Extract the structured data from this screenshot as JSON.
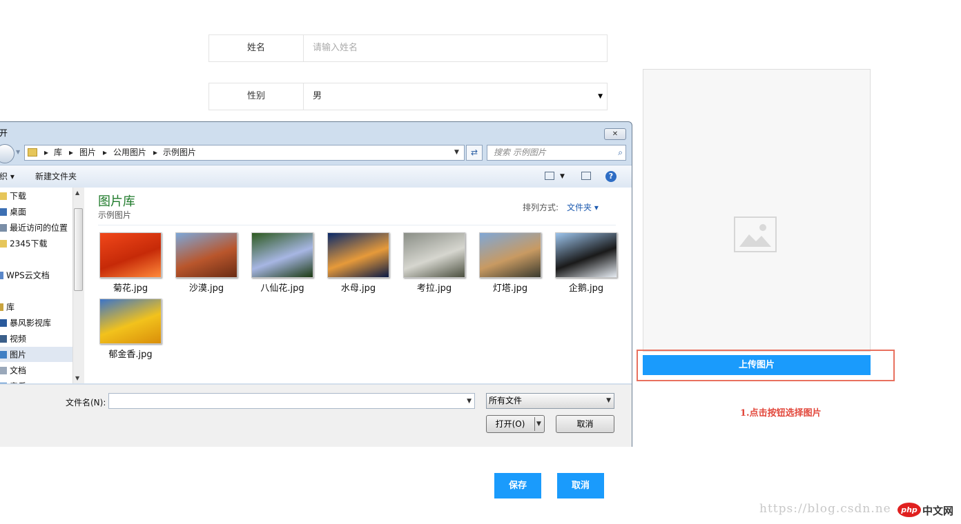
{
  "form": {
    "name_label": "姓名",
    "name_placeholder": "请输入姓名",
    "gender_label": "性别",
    "gender_value": "男"
  },
  "upload": {
    "button_label": "上传图片",
    "tip": "1.点击按钮选择图片"
  },
  "actions": {
    "save_label": "保存",
    "cancel_label": "取消"
  },
  "watermark": {
    "url_text": "https://blog.csdn.ne",
    "php_logo": "php",
    "site_text": "中文网"
  },
  "dialog": {
    "title": "开",
    "close_glyph": "✕",
    "breadcrumb": [
      "库",
      "图片",
      "公用图片",
      "示例图片"
    ],
    "search_placeholder": "搜索 示例图片",
    "toolbar": {
      "organize": "织 ▾",
      "new_folder": "新建文件夹"
    },
    "sidebar": [
      {
        "label": "下载",
        "icon": "download-folder-icon",
        "color": "#e6c65a"
      },
      {
        "label": "桌面",
        "icon": "desktop-icon",
        "color": "#3c6fb3"
      },
      {
        "label": "最近访问的位置",
        "icon": "recent-places-icon",
        "color": "#7a8ea7"
      },
      {
        "label": "2345下载",
        "icon": "folder-icon",
        "color": "#e6c65a"
      },
      {
        "label": "WPS云文档",
        "icon": "cloud-doc-icon",
        "color": "#5a87c9"
      },
      {
        "label": "库",
        "icon": "library-icon",
        "color": "#c9a43f"
      },
      {
        "label": "暴风影视库",
        "icon": "video-library-icon",
        "color": "#2a5a9c"
      },
      {
        "label": "视频",
        "icon": "video-icon",
        "color": "#3b5f8a"
      },
      {
        "label": "图片",
        "icon": "pictures-icon",
        "color": "#3f7fc4",
        "selected": true
      },
      {
        "label": "文档",
        "icon": "documents-icon",
        "color": "#9aa8ba"
      },
      {
        "label": "音乐",
        "icon": "music-icon",
        "color": "#3f7fc4"
      }
    ],
    "library_title": "图片库",
    "library_subtitle": "示例图片",
    "sort_label": "排列方式:",
    "sort_value": "文件夹 ▾",
    "files": [
      {
        "name": "菊花.jpg",
        "colors": [
          "#f0471a",
          "#c62a08",
          "#ff8a3a"
        ]
      },
      {
        "name": "沙漠.jpg",
        "colors": [
          "#7ca7d9",
          "#b9562c",
          "#6a2c14"
        ]
      },
      {
        "name": "八仙花.jpg",
        "colors": [
          "#2e5a20",
          "#a7b6e3",
          "#1c3a12"
        ]
      },
      {
        "name": "水母.jpg",
        "colors": [
          "#0a2a6a",
          "#e69a3a",
          "#0a1a45"
        ]
      },
      {
        "name": "考拉.jpg",
        "colors": [
          "#8a8e86",
          "#d6d6cf",
          "#4b4f3f"
        ]
      },
      {
        "name": "灯塔.jpg",
        "colors": [
          "#7fa7d6",
          "#c89a62",
          "#3a3a2e"
        ]
      },
      {
        "name": "企鹅.jpg",
        "colors": [
          "#9cc4ec",
          "#1a1a1a",
          "#e8eef5"
        ]
      },
      {
        "name": "郁金香.jpg",
        "colors": [
          "#3c74c8",
          "#f2c21c",
          "#d98e0a"
        ]
      }
    ],
    "filename_label": "文件名(N):",
    "filename_value": "",
    "filter_value": "所有文件",
    "open_label": "打开(O)",
    "cancel_label": "取消"
  }
}
